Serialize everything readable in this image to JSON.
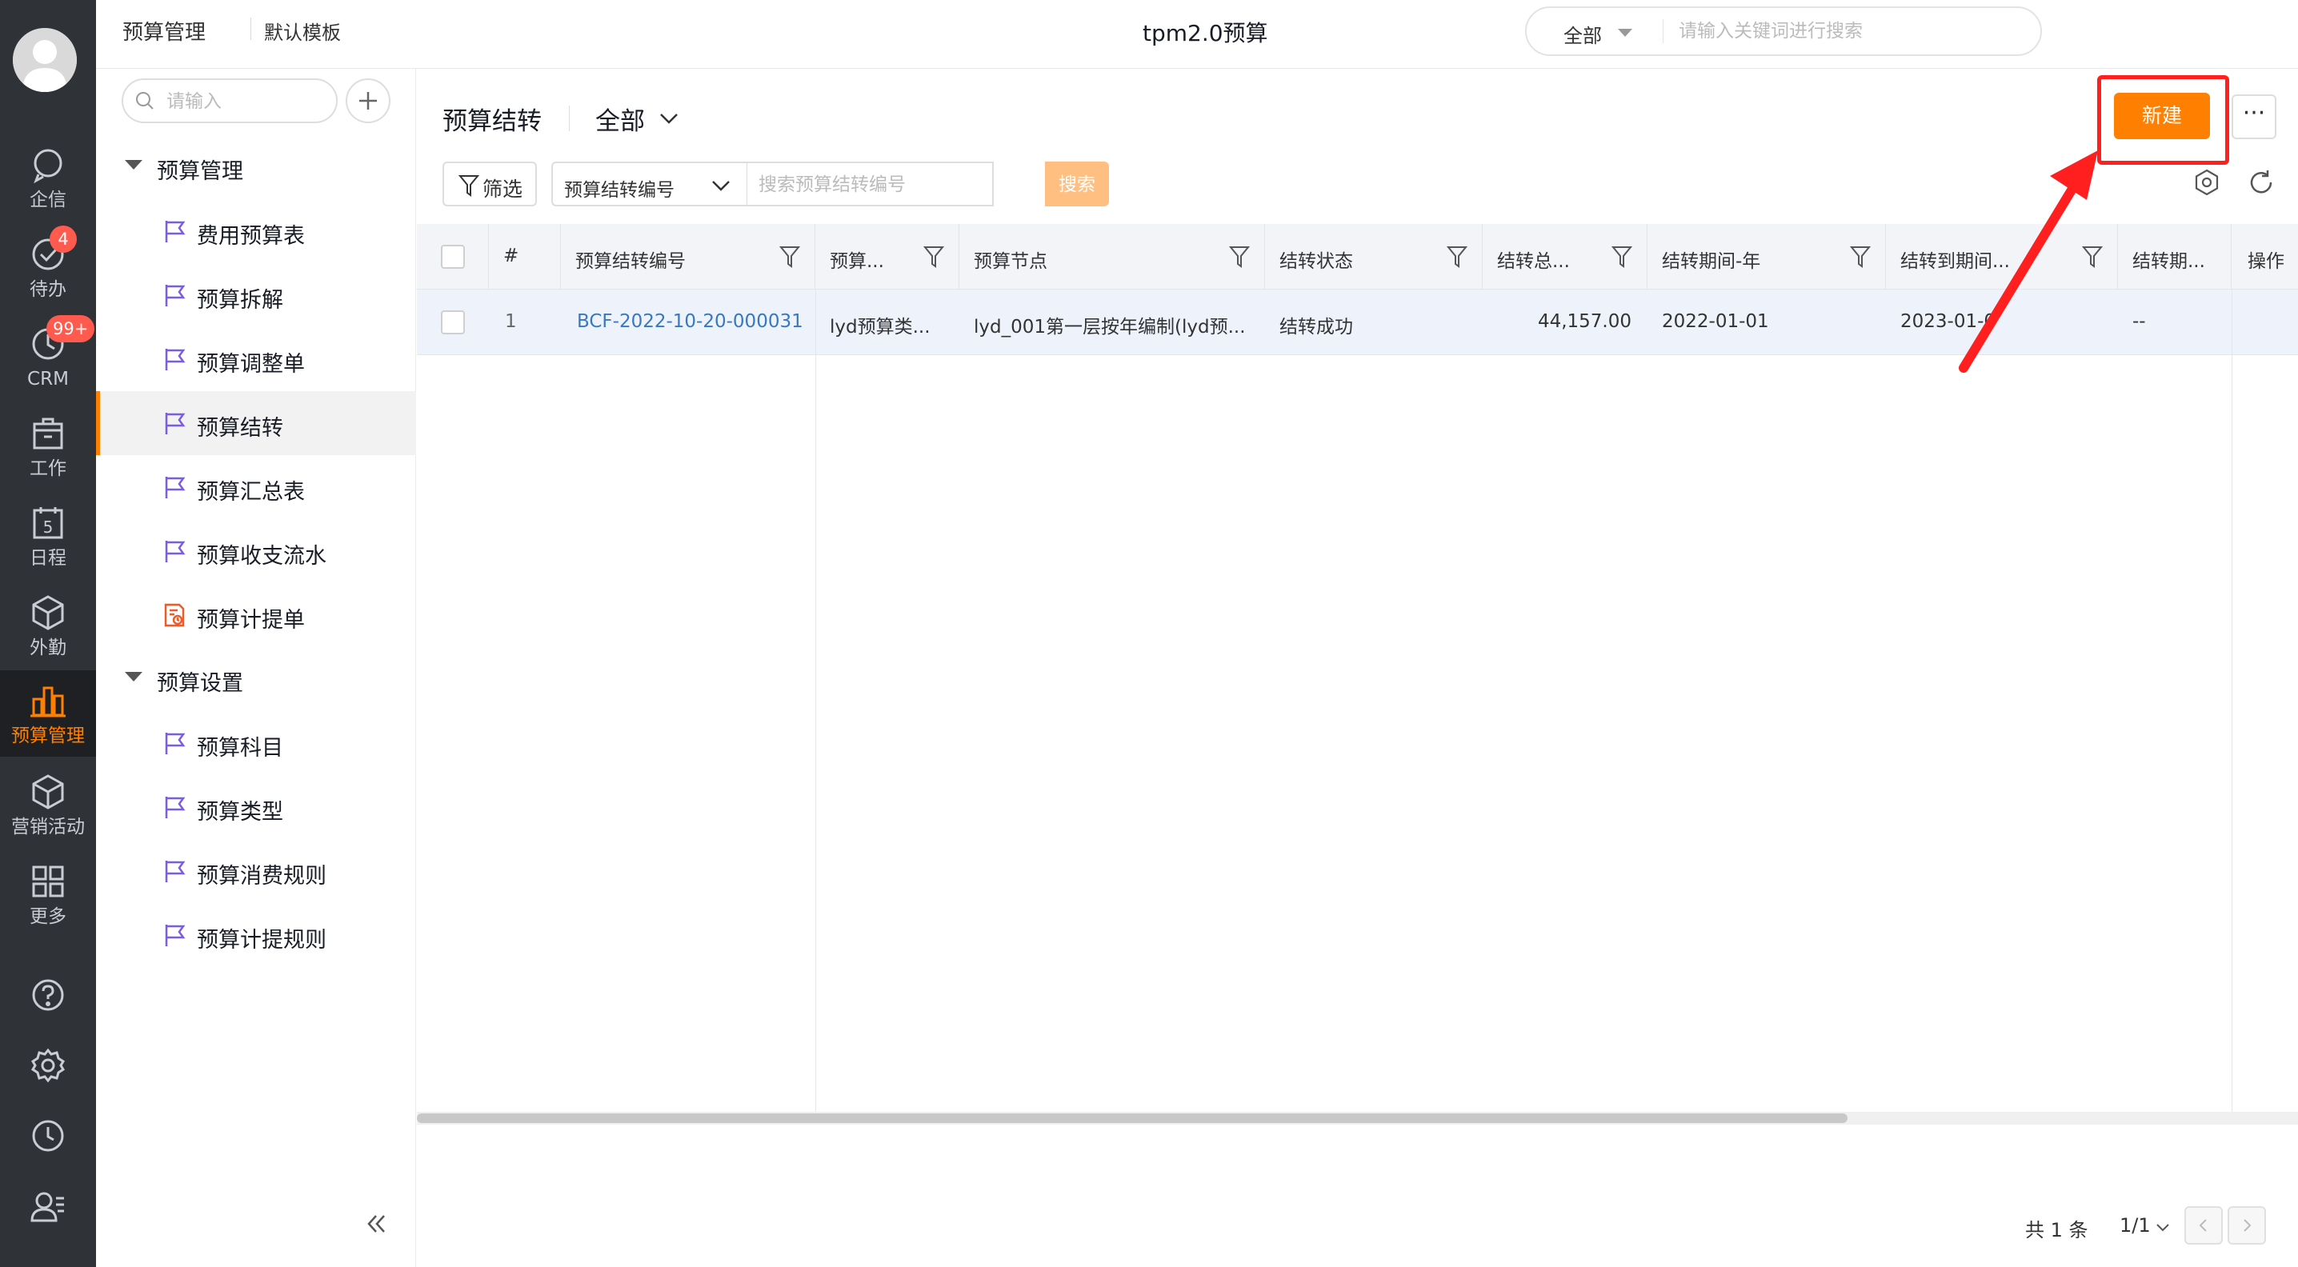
{
  "rail": {
    "items": [
      {
        "label": "企信",
        "icon": "chat-icon"
      },
      {
        "label": "待办",
        "icon": "todo-check-icon",
        "badge": "4"
      },
      {
        "label": "CRM",
        "icon": "crm-clock-icon",
        "badge": "99+"
      },
      {
        "label": "工作",
        "icon": "briefcase-icon"
      },
      {
        "label": "日程",
        "icon": "calendar-icon",
        "glyph": "5"
      },
      {
        "label": "外勤",
        "icon": "cube-icon"
      },
      {
        "label": "预算管理",
        "icon": "bar-chart-icon",
        "active": true
      },
      {
        "label": "营销活动",
        "icon": "box-icon"
      },
      {
        "label": "更多",
        "icon": "grid-icon"
      }
    ],
    "tools": [
      "help-icon",
      "settings-icon",
      "history-icon",
      "contacts-icon"
    ]
  },
  "topbar": {
    "app_name": "预算管理",
    "template": "默认模板",
    "title": "tpm2.0预算",
    "search_scope": "全部",
    "search_placeholder": "请输入关键词进行搜索"
  },
  "nav": {
    "search_placeholder": "请输入",
    "groups": [
      {
        "label": "预算管理",
        "items": [
          "费用预算表",
          "预算拆解",
          "预算调整单",
          "预算结转",
          "预算汇总表",
          "预算收支流水",
          "预算计提单"
        ]
      },
      {
        "label": "预算设置",
        "items": [
          "预算科目",
          "预算类型",
          "预算消费规则",
          "预算计提规则"
        ]
      }
    ],
    "active_item": "预算结转"
  },
  "main": {
    "title": "预算结转",
    "scope": "全部",
    "new_button": "新建",
    "more_button": "···",
    "filter_button": "筛选",
    "field_select": "预算结转编号",
    "search_placeholder": "搜索预算结转编号",
    "search_button": "搜索",
    "accent_color": "#ff8000",
    "highlight_color": "#ff1f1f"
  },
  "table": {
    "columns": [
      "#",
      "预算结转编号",
      "预算...",
      "预算节点",
      "结转状态",
      "结转总...",
      "结转期间-年",
      "结转到期间...",
      "结转期...",
      "操作"
    ],
    "rows": [
      {
        "index": "1",
        "code": "BCF-2022-10-20-000031",
        "type": "lyd预算类...",
        "node": "lyd_001第一层按年编制(lyd预...",
        "status": "结转成功",
        "total": "44,157.00",
        "period_year": "2022-01-01",
        "to_period": "2023-01-0",
        "period_other": "--",
        "action": ""
      }
    ]
  },
  "pagination": {
    "total": "共 1 条",
    "page": "1/1"
  }
}
